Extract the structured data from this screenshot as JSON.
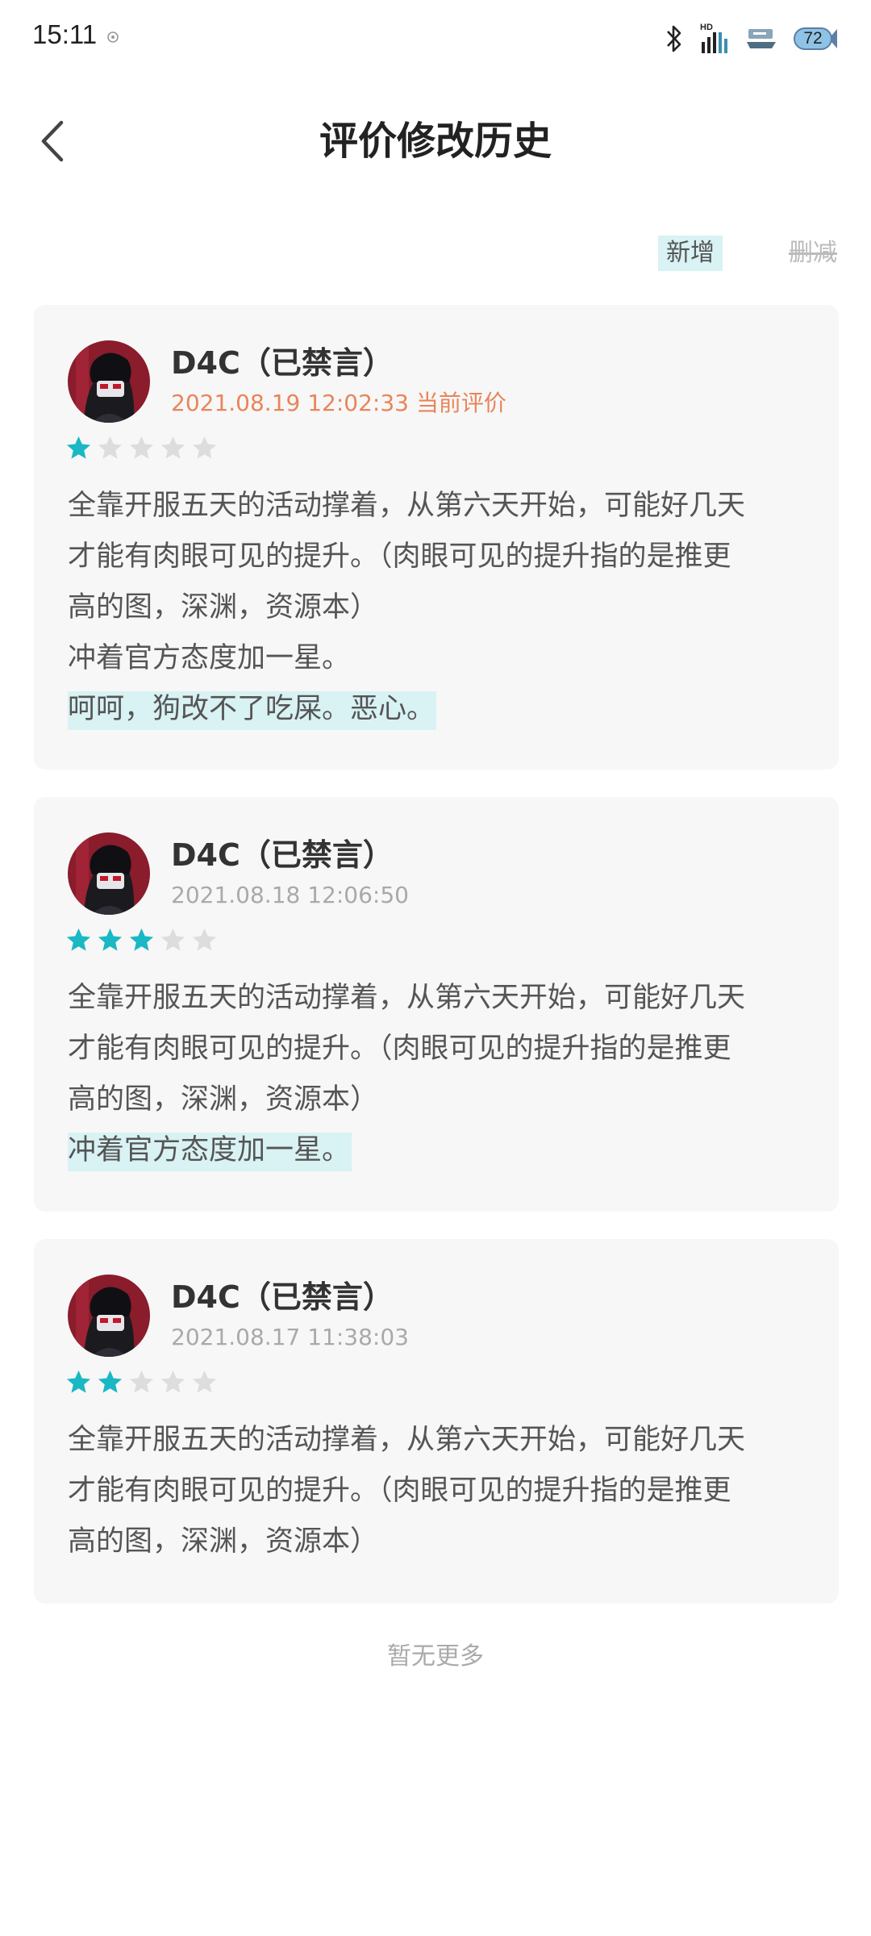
{
  "status_bar": {
    "time": "15:11",
    "hd_label": "HD",
    "battery": "72",
    "icons": [
      "bluetooth-icon",
      "signal-icon",
      "app-notification-icon",
      "battery-icon"
    ]
  },
  "header": {
    "title": "评价修改历史",
    "back_icon": "chevron-left-icon"
  },
  "legend": {
    "added": "新增",
    "removed": "删减"
  },
  "colors": {
    "star_filled": "#1ab7c4",
    "star_empty": "#dddddd",
    "highlight_added": "#d9f2f4",
    "current_meta": "#e8855a",
    "card_bg": "#f7f7f7"
  },
  "reviews": [
    {
      "user": "D4C（已禁言）",
      "datetime": "2021.08.19 12:02:33 当前评价",
      "is_current": true,
      "rating": 1,
      "max_rating": 5,
      "lines": [
        "全靠开服五天的活动撑着，从第六天开始，可能好几天",
        "才能有肉眼可见的提升。（肉眼可见的提升指的是推更",
        "高的图，深渊，资源本）",
        "冲着官方态度加一星。",
        "呵呵，狗改不了吃屎。恶心。"
      ]
    },
    {
      "user": "D4C（已禁言）",
      "datetime": "2021.08.18 12:06:50",
      "is_current": false,
      "rating": 3,
      "max_rating": 5,
      "lines": [
        "全靠开服五天的活动撑着，从第六天开始，可能好几天",
        "才能有肉眼可见的提升。（肉眼可见的提升指的是推更",
        "高的图，深渊，资源本）",
        "冲着官方态度加一星。"
      ]
    },
    {
      "user": "D4C（已禁言）",
      "datetime": "2021.08.17 11:38:03",
      "is_current": false,
      "rating": 2,
      "max_rating": 5,
      "lines": [
        "全靠开服五天的活动撑着，从第六天开始，可能好几天",
        "才能有肉眼可见的提升。（肉眼可见的提升指的是推更",
        "高的图，深渊，资源本）"
      ]
    }
  ],
  "footer": {
    "no_more": "暂无更多"
  }
}
